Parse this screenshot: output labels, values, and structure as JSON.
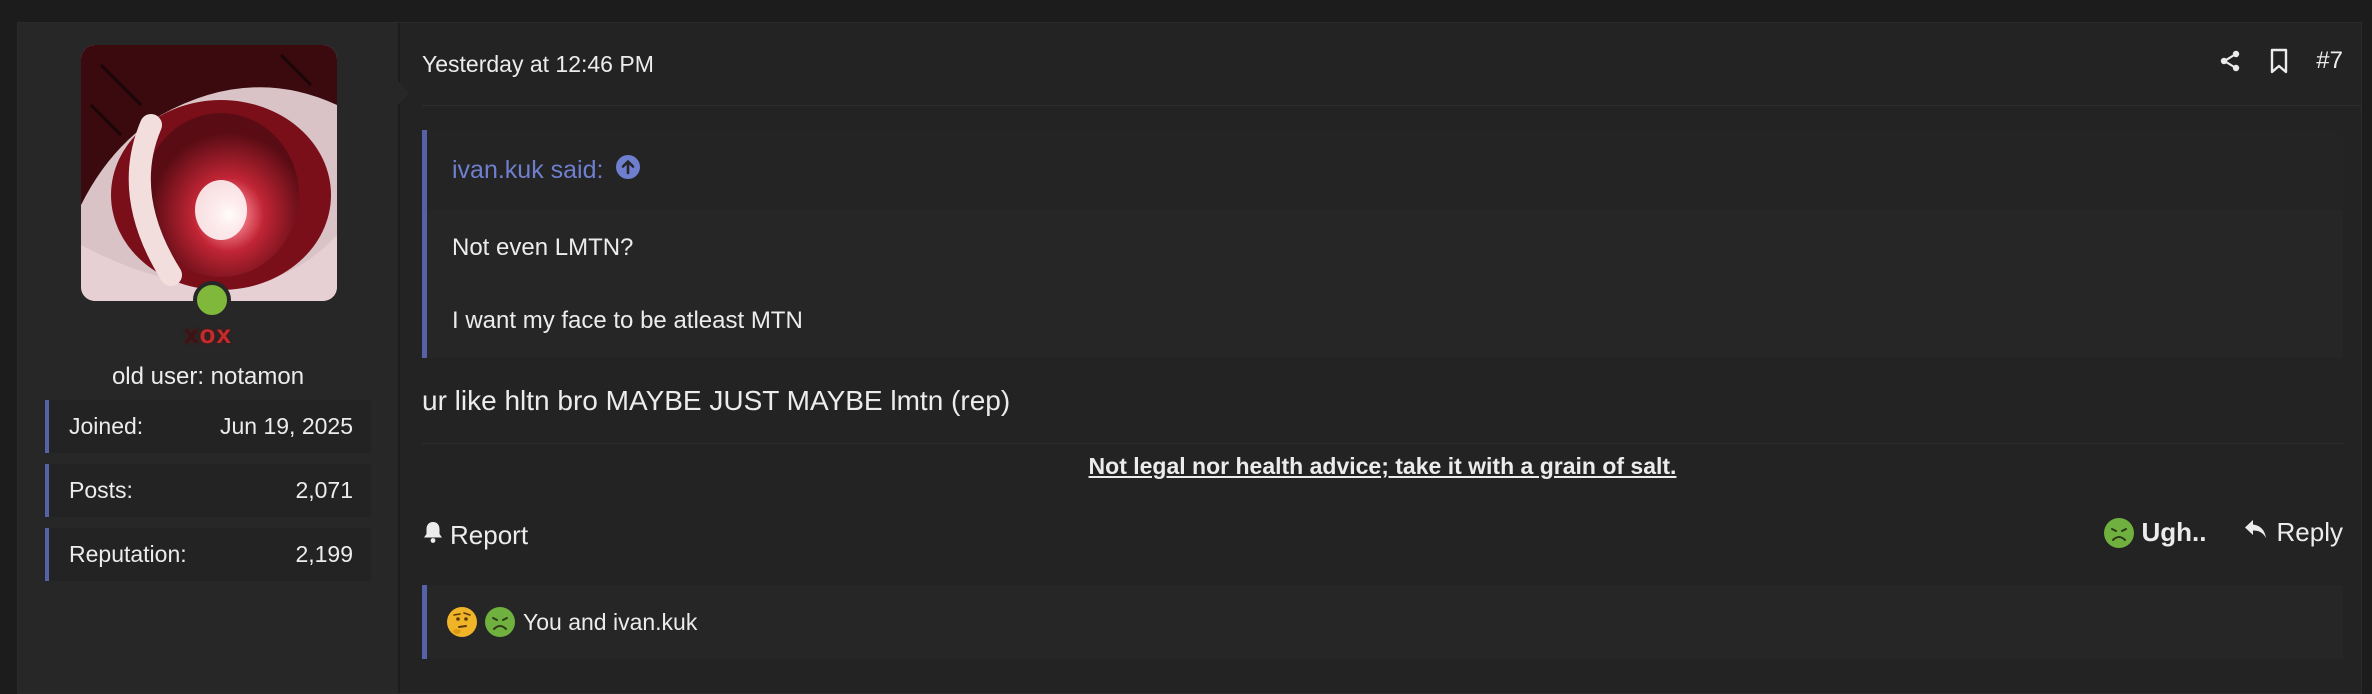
{
  "post": {
    "date": "Yesterday at 12:46 PM",
    "number": "#7",
    "message": "ur like hltn bro MAYBE JUST MAYBE lmtn (rep)",
    "signature": "Not legal nor health advice; take it with a grain of salt."
  },
  "user": {
    "username_prefix": "x",
    "username_mid": "o",
    "username_suffix": "x",
    "title": "old user: notamon",
    "online": true,
    "stats": [
      {
        "label": "Joined:",
        "value": "Jun 19, 2025"
      },
      {
        "label": "Posts:",
        "value": "2,071"
      },
      {
        "label": "Reputation:",
        "value": "2,199"
      }
    ]
  },
  "quote": {
    "author": "ivan.kuk said:",
    "lines": [
      "Not even LMTN?",
      "I want my face to be atleast MTN"
    ]
  },
  "actions": {
    "report": "Report",
    "reaction": "Ugh..",
    "reply": "Reply"
  },
  "reactions": {
    "summary": "You and ivan.kuk",
    "icons": [
      "thinking-face-emoji",
      "nauseated-face-emoji"
    ]
  },
  "colors": {
    "accent": "#5562a8",
    "quote_author": "#6f7fcf",
    "username": "#c62b2b",
    "online": "#7fb83a"
  }
}
